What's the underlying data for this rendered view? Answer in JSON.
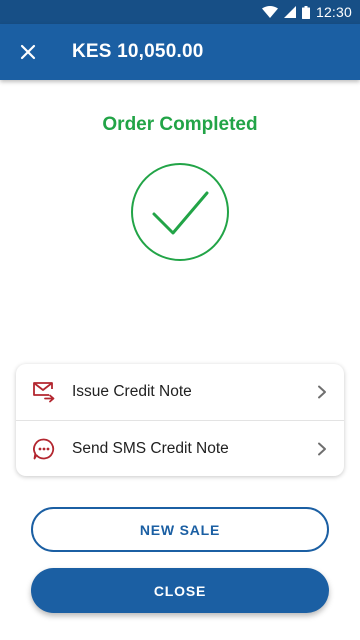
{
  "status_bar": {
    "time": "12:30"
  },
  "app_bar": {
    "title": "KES 10,050.00"
  },
  "main": {
    "heading": "Order Completed"
  },
  "actions": [
    {
      "label": "Issue Credit Note",
      "icon": "email-forward-icon"
    },
    {
      "label": "Send SMS Credit Note",
      "icon": "sms-icon"
    }
  ],
  "buttons": {
    "new_sale": "NEW SALE",
    "close": "CLOSE"
  },
  "colors": {
    "primary": "#1b5fa3",
    "status_bar": "#174f86",
    "success": "#22a447",
    "icon_red": "#b3262f"
  }
}
